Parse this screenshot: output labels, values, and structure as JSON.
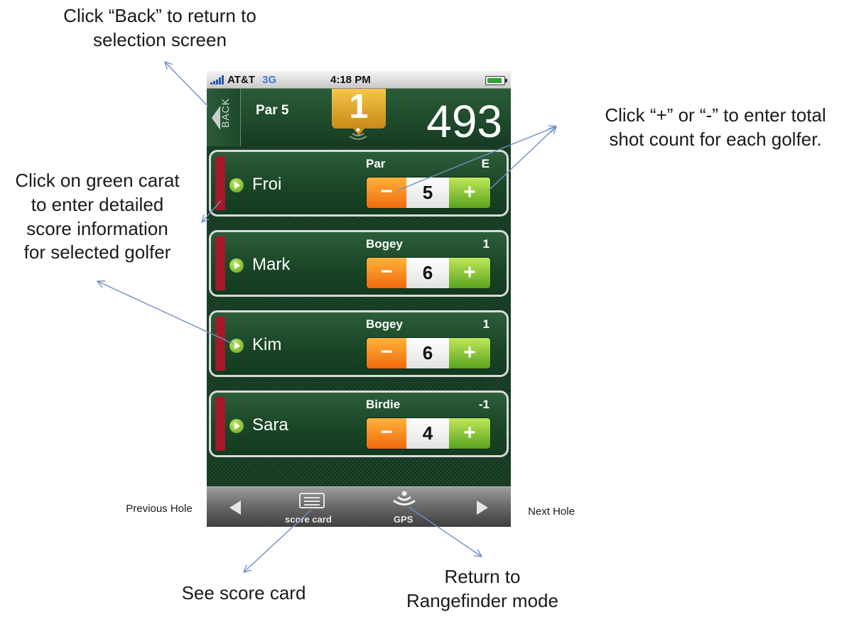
{
  "annotations": {
    "back_line1": "Click “Back” to return to",
    "back_line2": "selection screen",
    "plusminus_line1": "Click “+” or “-” to enter total",
    "plusminus_line2": "shot count for each golfer.",
    "carat_line1": "Click on green carat",
    "carat_line2": "to enter detailed",
    "carat_line3": "score information",
    "carat_line4": "for selected golfer",
    "previous_hole": "Previous Hole",
    "next_hole": "Next Hole",
    "score_card": "See score card",
    "rangefinder_line1": "Return to",
    "rangefinder_line2": "Rangefinder mode"
  },
  "status_bar": {
    "carrier": "AT&T",
    "network": "3G",
    "time": "4:18 PM"
  },
  "header": {
    "back_label": "BACK",
    "par": "Par 5",
    "hole_number": "1",
    "distance": "493"
  },
  "golfers": [
    {
      "name": "Froi",
      "term": "Par",
      "diff": "E",
      "strokes": "5"
    },
    {
      "name": "Mark",
      "term": "Bogey",
      "diff": "1",
      "strokes": "6"
    },
    {
      "name": "Kim",
      "term": "Bogey",
      "diff": "1",
      "strokes": "6"
    },
    {
      "name": "Sara",
      "term": "Birdie",
      "diff": "-1",
      "strokes": "4"
    }
  ],
  "stepper": {
    "minus_label": "−",
    "plus_label": "+"
  },
  "toolbar": {
    "score_card_label": "score card",
    "gps_label": "GPS"
  },
  "colors": {
    "background_green": "#1d4a2c",
    "hole_badge_gold": "#e2a52c",
    "minus_orange": "#f28a1e",
    "plus_green": "#7cc233",
    "player_stripe_red": "#a4182a",
    "arrow_blue": "#6f8fc2"
  }
}
